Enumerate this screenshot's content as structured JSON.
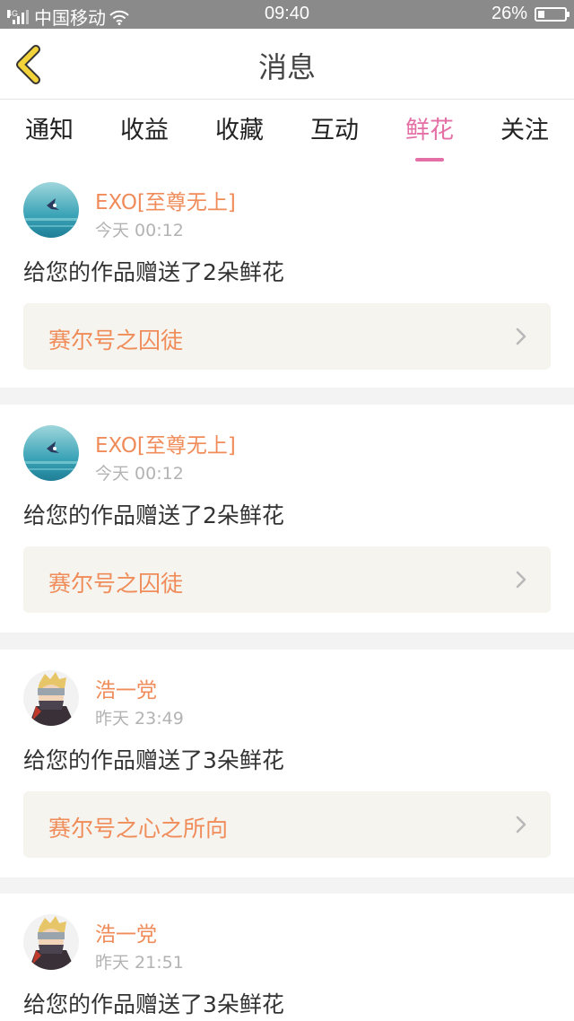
{
  "status_bar": {
    "network": "4G",
    "carrier": "中国移动",
    "time": "09:40",
    "battery": "26%",
    "battery_level": 0.26
  },
  "header": {
    "title": "消息",
    "back_icon": "chevron-left-icon"
  },
  "tabs": [
    {
      "label": "通知",
      "active": false
    },
    {
      "label": "收益",
      "active": false
    },
    {
      "label": "收藏",
      "active": false
    },
    {
      "label": "互动",
      "active": false
    },
    {
      "label": "鲜花",
      "active": true
    },
    {
      "label": "关注",
      "active": false
    }
  ],
  "messages": [
    {
      "username": "EXO[至尊无上]",
      "time": "今天 00:12",
      "message": "给您的作品赠送了2朵鲜花",
      "work_title": "赛尔号之囚徒",
      "avatar": "bird-ocean-avatar"
    },
    {
      "username": "EXO[至尊无上]",
      "time": "今天 00:12",
      "message": "给您的作品赠送了2朵鲜花",
      "work_title": "赛尔号之囚徒",
      "avatar": "bird-ocean-avatar"
    },
    {
      "username": "浩一党",
      "time": "昨天 23:49",
      "message": "给您的作品赠送了3朵鲜花",
      "work_title": "赛尔号之心之所向",
      "avatar": "ninja-character-avatar"
    },
    {
      "username": "浩一党",
      "time": "昨天 21:51",
      "message": "给您的作品赠送了3朵鲜花",
      "work_title": "",
      "avatar": "ninja-character-avatar"
    }
  ],
  "colors": {
    "accent_pink": "#e36fa5",
    "username_orange": "#f08c5a",
    "back_arrow_yellow": "#f2d43a"
  }
}
